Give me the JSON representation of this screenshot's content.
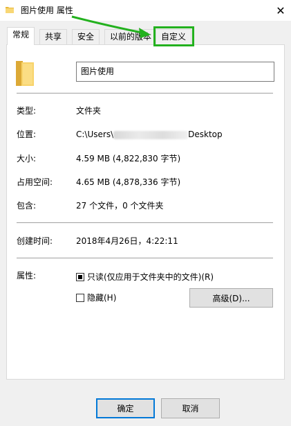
{
  "window": {
    "title": "图片使用 属性",
    "close_glyph": "✕"
  },
  "tabs": [
    {
      "label": "常规",
      "active": true
    },
    {
      "label": "共享",
      "active": false
    },
    {
      "label": "安全",
      "active": false
    },
    {
      "label": "以前的版本",
      "active": false
    },
    {
      "label": "自定义",
      "active": false
    }
  ],
  "general": {
    "folder_name": "图片使用",
    "type_label": "类型:",
    "type_value": "文件夹",
    "location_label": "位置:",
    "location_prefix": "C:\\Users\\",
    "location_suffix": "Desktop",
    "size_label": "大小:",
    "size_value": "4.59 MB (4,822,830 字节)",
    "disk_label": "占用空间:",
    "disk_value": "4.65 MB (4,878,336 字节)",
    "contains_label": "包含:",
    "contains_value": "27 个文件，0 个文件夹",
    "created_label": "创建时间:",
    "created_value": "2018年4月26日，4:22:11",
    "attributes_label": "属性:",
    "readonly_label": "只读(仅应用于文件夹中的文件)(R)",
    "readonly_checked": true,
    "hidden_label": "隐藏(H)",
    "hidden_checked": false,
    "advanced_button": "高级(D)..."
  },
  "footer": {
    "ok": "确定",
    "cancel": "取消"
  },
  "highlight_color": "#23b11e",
  "icons": [
    "folder-icon",
    "close-icon",
    "arrow-annotation"
  ]
}
